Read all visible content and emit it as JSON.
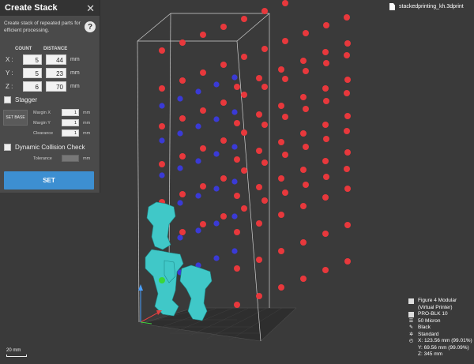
{
  "panel": {
    "title": "Create Stack",
    "description": "Create stack of repeated parts for efficient processing.",
    "count_header": "COUNT",
    "distance_header": "DISTANCE",
    "axes": [
      {
        "label": "X :",
        "count": "5",
        "distance": "44",
        "unit": "mm"
      },
      {
        "label": "Y :",
        "count": "5",
        "distance": "23",
        "unit": "mm"
      },
      {
        "label": "Z :",
        "count": "6",
        "distance": "70",
        "unit": "mm"
      }
    ],
    "stagger_label": "Stagger",
    "set_base_label": "SET BASE",
    "margins": [
      {
        "label": "Margin X",
        "value": "1",
        "unit": "mm"
      },
      {
        "label": "Margin Y",
        "value": "1",
        "unit": "mm"
      },
      {
        "label": "Clearance",
        "value": "1",
        "unit": "mm"
      }
    ],
    "collision_label": "Dynamic Collision Check",
    "tolerance_label": "Tolerance",
    "tolerance_value": "",
    "tolerance_unit": "mm",
    "set_label": "SET"
  },
  "file_name": "stackedprinting_kh.3dprint",
  "printer_info": {
    "printer": "Figure 4 Modular (Virtual Printer)",
    "material": "PRO-BLK 10",
    "layer": "50 Micron",
    "color": "Black",
    "quality": "Standard",
    "x": "X:  123.56 mm (99.01%)",
    "y": "Y:  69.56 mm (99.09%)",
    "z": "Z:  345 mm"
  },
  "scale_label": "20 mm",
  "colors": {
    "red": "#e8383c",
    "blue": "#3a3ad6",
    "accent": "#3d8fd1",
    "part": "#40c8c8"
  }
}
